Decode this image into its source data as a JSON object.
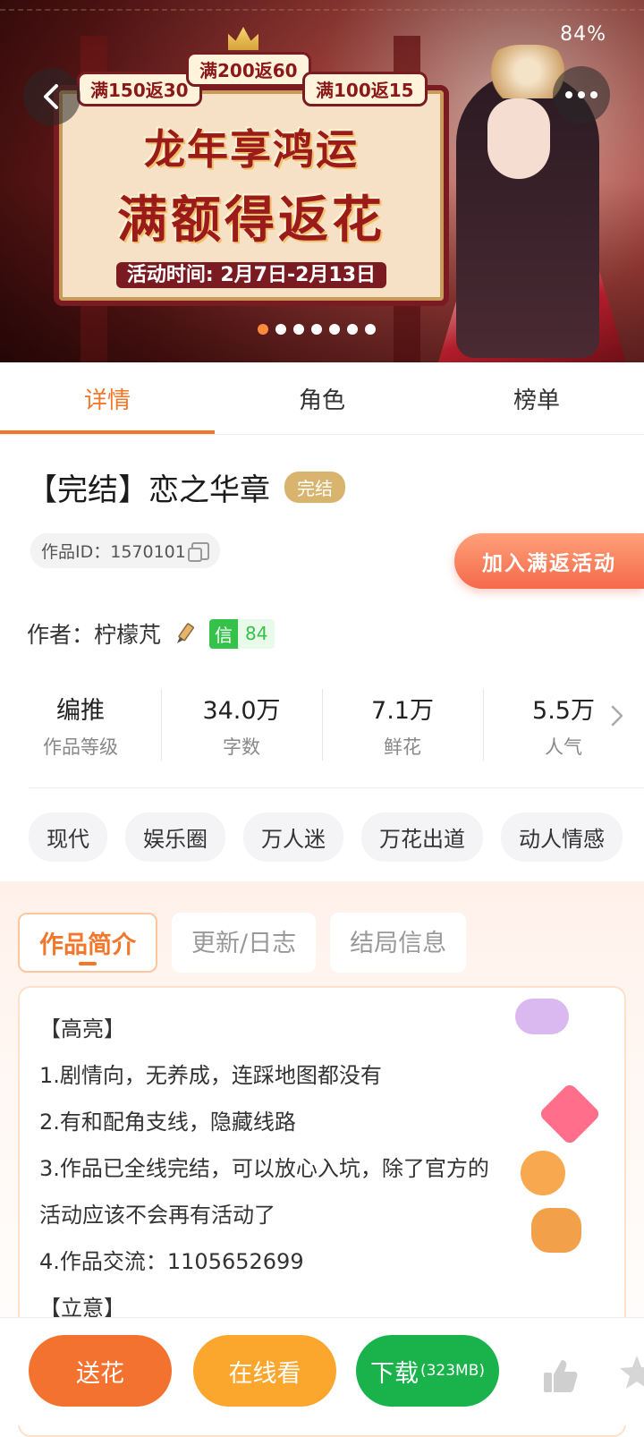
{
  "banner": {
    "status_battery": "84%",
    "promo_1": "满150返30",
    "promo_2": "满200返60",
    "promo_3": "满100返15",
    "title_line1": "龙年享鸿运",
    "title_line2": "满额得返花",
    "date": "活动时间: 2月7日-2月13日",
    "carousel_total": 7,
    "carousel_active": 1
  },
  "tabs": [
    "详情",
    "角色",
    "榜单"
  ],
  "work": {
    "title": "【完结】恋之华章",
    "status_badge": "完结",
    "id_label": "作品ID：1570101",
    "join_button": "加入满返活动",
    "author_label": "作者：柠檬芃",
    "credit_label": "信",
    "credit_value": "84"
  },
  "stats": [
    {
      "value": "编推",
      "label": "作品等级"
    },
    {
      "value": "34.0万",
      "label": "字数"
    },
    {
      "value": "7.1万",
      "label": "鲜花"
    },
    {
      "value": "5.5万",
      "label": "人气"
    }
  ],
  "tags": [
    "现代",
    "娱乐圈",
    "万人迷",
    "万花出道",
    "动人情感"
  ],
  "sub_tabs": [
    "作品简介",
    "更新/日志",
    "结局信息"
  ],
  "intro_lines": [
    "【高亮】",
    "1.剧情向，无养成，连踩地图都没有",
    "2.有和配角支线，隐藏线路",
    "3.作品已全线完结，可以放心入坑，除了官方的",
    "活动应该不会再有活动了",
    "4.作品交流：1105652699",
    "【立意】"
  ],
  "bottom": {
    "flower": "送花",
    "read": "在线看",
    "download": "下载",
    "download_size": "(323MB)"
  },
  "colors": {
    "accent": "#f2772a",
    "download_green": "#19b24b",
    "read_yellow": "#fba72e"
  }
}
